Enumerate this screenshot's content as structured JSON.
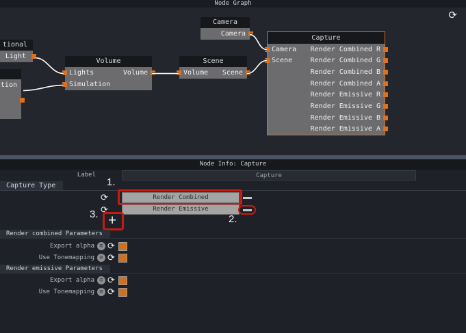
{
  "app": {
    "graph_panel_title": "Node Graph",
    "info_panel_title": "Node Info: Capture"
  },
  "graph": {
    "nodes": {
      "directional": {
        "title": "tional",
        "output_label": "Light"
      },
      "simulation": {
        "output_label": "ation"
      },
      "camera": {
        "title": "Camera",
        "output_label": "Camera"
      },
      "volume": {
        "title": "Volume",
        "input1": "Lights",
        "input2": "Simulation",
        "output_label": "Volume"
      },
      "scene": {
        "title": "Scene",
        "input_label": "Volume",
        "output_label": "Scene"
      },
      "capture": {
        "title": "Capture",
        "inputs": [
          "Camera",
          "Scene"
        ],
        "outputs": [
          "Render Combined R",
          "Render Combined G",
          "Render Combined B",
          "Render Combined A",
          "Render Emissive R",
          "Render Emissive G",
          "Render Emissive B",
          "Render Emissive A"
        ]
      }
    }
  },
  "info": {
    "label_row": {
      "label": "Label",
      "value": "Capture"
    },
    "capture_type": {
      "section_title": "Capture Type",
      "entries": [
        "Render Combined",
        "Render Emissive"
      ],
      "add_button": "+"
    },
    "annotations": {
      "n1": "1.",
      "n2": "2.",
      "n3": "3."
    },
    "param_sections": [
      {
        "title": "Render combined Parameters",
        "rows": [
          {
            "label": "Export alpha",
            "checked": true
          },
          {
            "label": "Use Tonemapping",
            "checked": true
          }
        ]
      },
      {
        "title": "Render emissive Parameters",
        "rows": [
          {
            "label": "Export alpha",
            "checked": true
          },
          {
            "label": "Use Tonemapping",
            "checked": true
          }
        ]
      }
    ]
  },
  "colors": {
    "accent_orange": "#df701d",
    "annotation_red": "#cb1a12",
    "node_body_gray": "#6c6c6e",
    "node_header": "#16181c"
  }
}
